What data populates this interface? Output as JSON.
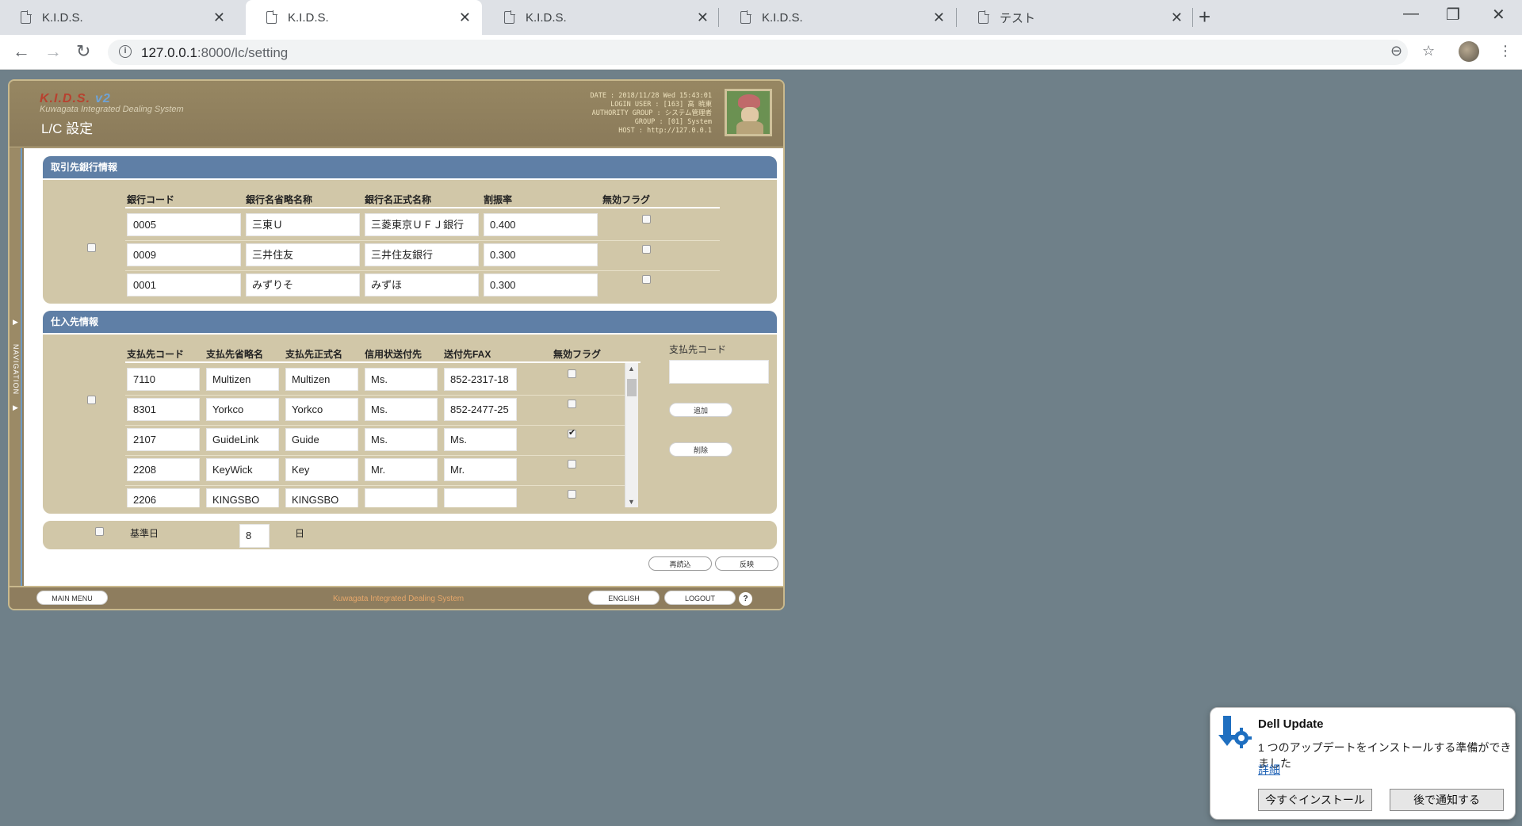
{
  "browser": {
    "tabs": [
      {
        "title": "K.I.D.S.",
        "active": false
      },
      {
        "title": "K.I.D.S.",
        "active": true
      },
      {
        "title": "K.I.D.S.",
        "active": false
      },
      {
        "title": "K.I.D.S.",
        "active": false
      },
      {
        "title": "テスト",
        "active": false
      }
    ],
    "url_host": "127.0.0.1",
    "url_rest": ":8000/lc/setting"
  },
  "header": {
    "logo": "K.I.D.S.",
    "logo_version": "v2",
    "logo_subtitle": "Kuwagata Integrated Dealing System",
    "page_title": "L/C 設定",
    "info": {
      "date": "DATE : 2018/11/28 Wed 15:43:01",
      "login_user": "LOGIN USER : [163] 高 暁東",
      "authority_group": "AUTHORITY GROUP : システム管理者",
      "group": "GROUP : [01] System",
      "host": "HOST : http://127.0.0.1"
    }
  },
  "navigation": {
    "label": "NAVIGATION"
  },
  "bank_section": {
    "title": "取引先銀行情報",
    "columns": [
      "銀行コード",
      "銀行名省略名称",
      "銀行名正式名称",
      "割振率",
      "無効フラグ"
    ],
    "rows": [
      {
        "code": "0005",
        "short": "三東Ｕ",
        "full": "三菱東京ＵＦＪ銀行",
        "rate": "0.400",
        "invalid": false
      },
      {
        "code": "0009",
        "short": "三井住友",
        "full": "三井住友銀行",
        "rate": "0.300",
        "invalid": false
      },
      {
        "code": "0001",
        "short": "みずりそ",
        "full": "みずほ",
        "rate": "0.300",
        "invalid": false
      }
    ]
  },
  "supplier_section": {
    "title": "仕入先情報",
    "columns": [
      "支払先コード",
      "支払先省略名",
      "支払先正式名",
      "信用状送付先",
      "送付先FAX",
      "無効フラグ"
    ],
    "rows": [
      {
        "code": "7110",
        "short": "Multizen",
        "full": "Multizen",
        "send_to": "Ms.",
        "fax": "852-2317-18",
        "invalid": false
      },
      {
        "code": "8301",
        "short": "Yorkco",
        "full": "Yorkco",
        "send_to": "Ms.",
        "fax": "852-2477-25",
        "invalid": false
      },
      {
        "code": "2107",
        "short": "GuideLink",
        "full": "Guide",
        "send_to": "Ms.",
        "fax": "Ms.",
        "invalid": true
      },
      {
        "code": "2208",
        "short": "KeyWick",
        "full": "Key",
        "send_to": "Mr.",
        "fax": "Mr.",
        "invalid": false
      },
      {
        "code": "2206",
        "short": "KINGSBO",
        "full": "KINGSBO",
        "send_to": "",
        "fax": "",
        "invalid": false
      }
    ],
    "side_label": "支払先コード",
    "side_input": "",
    "add_label": "追加",
    "delete_label": "削除"
  },
  "base_date": {
    "label": "基準日",
    "value": "8",
    "unit": "日"
  },
  "actions": {
    "reload_label": "再読込",
    "apply_label": "反映"
  },
  "footer": {
    "main_menu_label": "MAIN MENU",
    "system_name": "Kuwagata Integrated Dealing System",
    "english_label": "ENGLISH",
    "logout_label": "LOGOUT",
    "help_label": "?"
  },
  "notification": {
    "title": "Dell Update",
    "message": "1 つのアップデートをインストールする準備ができました",
    "link": "詳細",
    "install_label": "今すぐインストール",
    "later_label": "後で通知する"
  },
  "colors": {
    "desktop": "#6f8089",
    "frame": "#8e7d5e",
    "panel": "#d1c7a8",
    "panel_header": "#5f7fa6"
  }
}
